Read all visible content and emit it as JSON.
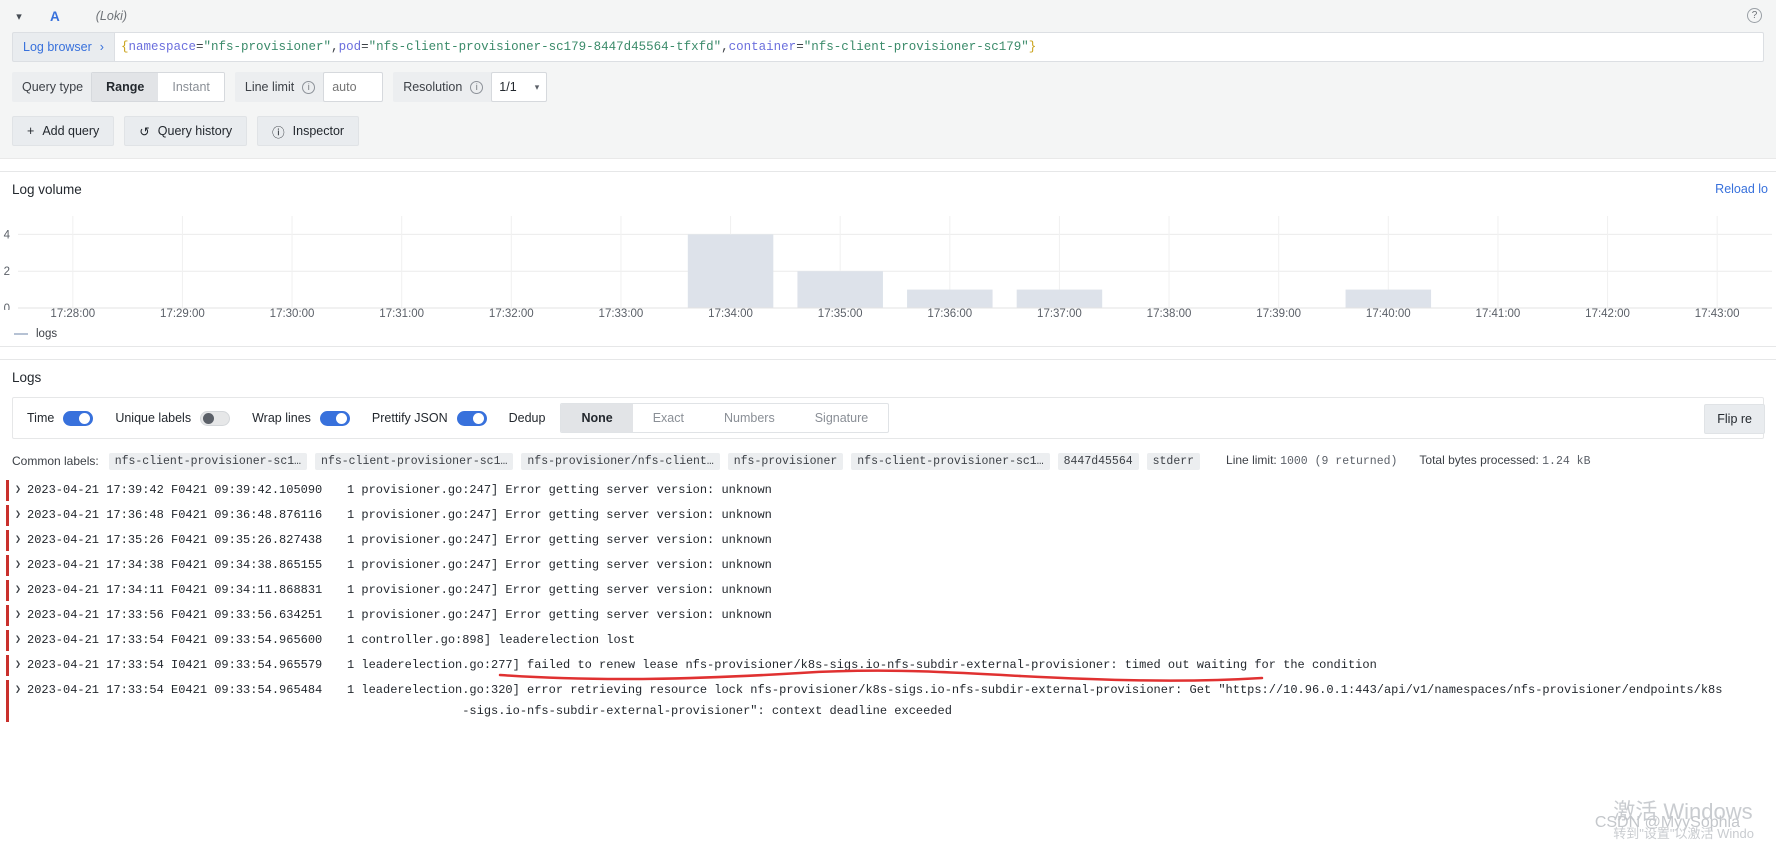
{
  "query": {
    "ref_id": "A",
    "datasource": "(Loki)",
    "collapse_icon": "chevron-down-icon",
    "help_icon": "help-circle-icon",
    "log_browser_label": "Log browser",
    "log_browser_chevron": "›",
    "expression": {
      "full": "{namespace=\"nfs-provisioner\",pod=\"nfs-client-provisioner-sc179-8447d45564-tfxfd\",container=\"nfs-client-provisioner-sc179\"}",
      "tokens": [
        {
          "t": "{",
          "c": "brace"
        },
        {
          "t": "namespace",
          "c": "key"
        },
        {
          "t": "=",
          "c": "eq"
        },
        {
          "t": "\"nfs-provisioner\"",
          "c": "str"
        },
        {
          "t": ",",
          "c": "comma"
        },
        {
          "t": "pod",
          "c": "key"
        },
        {
          "t": "=",
          "c": "eq"
        },
        {
          "t": "\"nfs-client-provisioner-sc179-8447d45564-tfxfd\"",
          "c": "str"
        },
        {
          "t": ",",
          "c": "comma"
        },
        {
          "t": "container",
          "c": "key"
        },
        {
          "t": "=",
          "c": "eq"
        },
        {
          "t": "\"nfs-client-provisioner-sc179\"",
          "c": "str"
        },
        {
          "t": "}",
          "c": "brace"
        }
      ]
    },
    "query_type_label": "Query type",
    "query_type_options": [
      "Range",
      "Instant"
    ],
    "query_type_selected": "Range",
    "line_limit_label": "Line limit",
    "line_limit_placeholder": "auto",
    "line_limit_value": "",
    "resolution_label": "Resolution",
    "resolution_value": "1/1",
    "actions": [
      {
        "label": "Add query",
        "icon": "plus-icon"
      },
      {
        "label": "Query history",
        "icon": "history-icon"
      },
      {
        "label": "Inspector",
        "icon": "info-circle-icon"
      }
    ]
  },
  "log_volume": {
    "title": "Log volume",
    "reload_label": "Reload lo"
  },
  "chart_data": {
    "type": "bar",
    "title": "Log volume",
    "xlabel": "",
    "ylabel": "",
    "ylim": [
      0,
      5
    ],
    "yticks": [
      0,
      2,
      4
    ],
    "grid": true,
    "legend_position": "bottom-left",
    "bar_color": "#dde2ea",
    "series": [
      {
        "name": "logs",
        "categories": [
          "17:28:00",
          "17:29:00",
          "17:30:00",
          "17:31:00",
          "17:32:00",
          "17:33:00",
          "17:34:00",
          "17:35:00",
          "17:36:00",
          "17:37:00",
          "17:38:00",
          "17:39:00",
          "17:40:00",
          "17:41:00",
          "17:42:00",
          "17:43:00"
        ],
        "values": [
          0,
          0,
          0,
          0,
          0,
          0,
          4,
          2,
          1,
          1,
          0,
          0,
          1,
          0,
          0,
          0
        ]
      }
    ],
    "xticks": [
      "17:28:00",
      "17:29:00",
      "17:30:00",
      "17:31:00",
      "17:32:00",
      "17:33:00",
      "17:34:00",
      "17:35:00",
      "17:36:00",
      "17:37:00",
      "17:38:00",
      "17:39:00",
      "17:40:00",
      "17:41:00",
      "17:42:00",
      "17:43:00"
    ],
    "legend": [
      "logs"
    ]
  },
  "logs": {
    "title": "Logs",
    "controls": {
      "time_label": "Time",
      "time_on": true,
      "unique_labels_label": "Unique labels",
      "unique_labels_on": false,
      "wrap_lines_label": "Wrap lines",
      "wrap_lines_on": true,
      "prettify_json_label": "Prettify JSON",
      "prettify_json_on": true,
      "dedup_label": "Dedup",
      "dedup_options": [
        "None",
        "Exact",
        "Numbers",
        "Signature"
      ],
      "dedup_selected": "None",
      "flip_label": "Flip re"
    },
    "common_labels_title": "Common labels:",
    "common_labels": [
      "nfs-client-provisioner-sc1…",
      "nfs-client-provisioner-sc1…",
      "nfs-provisioner/nfs-client…",
      "nfs-provisioner",
      "nfs-client-provisioner-sc1…",
      "8447d45564",
      "stderr"
    ],
    "line_limit_stat_label": "Line limit:",
    "line_limit_stat_value": "1000  (9 returned)",
    "bytes_stat_label": "Total bytes processed:",
    "bytes_stat_value": "1.24 kB",
    "rows": [
      {
        "level": "error",
        "timestamp": "2023-04-21 17:39:42",
        "prefix": "F0421 09:39:42.105090",
        "count": "1",
        "message": "provisioner.go:247] Error getting server version: unknown"
      },
      {
        "level": "error",
        "timestamp": "2023-04-21 17:36:48",
        "prefix": "F0421 09:36:48.876116",
        "count": "1",
        "message": "provisioner.go:247] Error getting server version: unknown"
      },
      {
        "level": "error",
        "timestamp": "2023-04-21 17:35:26",
        "prefix": "F0421 09:35:26.827438",
        "count": "1",
        "message": "provisioner.go:247] Error getting server version: unknown"
      },
      {
        "level": "error",
        "timestamp": "2023-04-21 17:34:38",
        "prefix": "F0421 09:34:38.865155",
        "count": "1",
        "message": "provisioner.go:247] Error getting server version: unknown"
      },
      {
        "level": "error",
        "timestamp": "2023-04-21 17:34:11",
        "prefix": "F0421 09:34:11.868831",
        "count": "1",
        "message": "provisioner.go:247] Error getting server version: unknown"
      },
      {
        "level": "error",
        "timestamp": "2023-04-21 17:33:56",
        "prefix": "F0421 09:33:56.634251",
        "count": "1",
        "message": "provisioner.go:247] Error getting server version: unknown"
      },
      {
        "level": "error",
        "timestamp": "2023-04-21 17:33:54",
        "prefix": "F0421 09:33:54.965600",
        "count": "1",
        "message": "controller.go:898] leaderelection lost"
      },
      {
        "level": "error",
        "timestamp": "2023-04-21 17:33:54",
        "prefix": "I0421 09:33:54.965579",
        "count": "1",
        "message": "leaderelection.go:277] failed to renew lease nfs-provisioner/k8s-sigs.io-nfs-subdir-external-provisioner: timed out waiting for the condition"
      },
      {
        "level": "error",
        "timestamp": "2023-04-21 17:33:54",
        "prefix": "E0421 09:33:54.965484",
        "count": "1",
        "message": "leaderelection.go:320] error retrieving resource lock nfs-provisioner/k8s-sigs.io-nfs-subdir-external-provisioner: Get \"https://10.96.0.1:443/api/v1/namespaces/nfs-provisioner/endpoints/k8s\n                -sigs.io-nfs-subdir-external-provisioner\": context deadline exceeded"
      }
    ]
  },
  "annotation": {
    "underline_color": "#e03131",
    "note": "red hand-drawn underline"
  },
  "watermark": {
    "windows_line1": "激活 Windows",
    "windows_line2": "转到\"设置\"以激活 Windo",
    "csdn": "CSDN @MyySophia"
  },
  "colors": {
    "accent": "#3871dc",
    "bar": "#dde2ea",
    "error_bar": "#c9302c",
    "panel_bg": "#f4f5f5"
  }
}
